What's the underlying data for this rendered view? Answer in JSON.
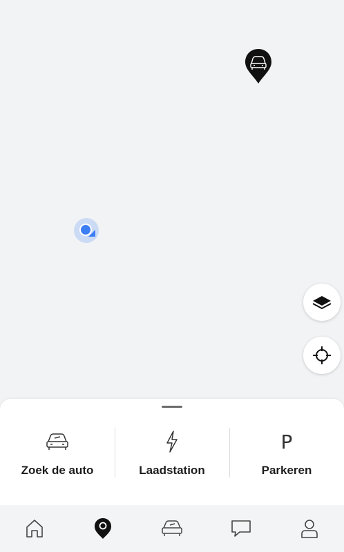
{
  "map": {
    "car_pin_icon": "car-location-pin-icon",
    "user_location_icon": "user-location-icon",
    "layers_button_icon": "layers-icon",
    "recenter_button_icon": "crosshair-icon"
  },
  "sheet": {
    "actions": [
      {
        "label": "Zoek de auto",
        "icon": "car-icon"
      },
      {
        "label": "Laadstation",
        "icon": "lightning-icon"
      },
      {
        "label": "Parkeren",
        "icon": "parking-icon",
        "glyph": "P"
      }
    ]
  },
  "tabbar": {
    "tabs": [
      {
        "icon": "home-icon",
        "active": false
      },
      {
        "icon": "map-pin-icon",
        "active": true
      },
      {
        "icon": "car-icon",
        "active": false
      },
      {
        "icon": "chat-icon",
        "active": false
      },
      {
        "icon": "profile-icon",
        "active": false
      }
    ]
  },
  "colors": {
    "map_background": "#f2f3f5",
    "location_blue": "#3d7ef5",
    "pin_black": "#111111"
  }
}
